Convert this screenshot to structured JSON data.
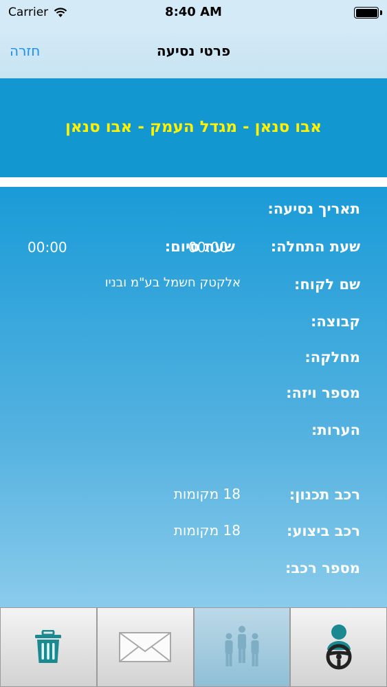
{
  "status_bar": {
    "carrier": "Carrier",
    "time": "8:40 AM"
  },
  "nav": {
    "title": "פרטי נסיעה",
    "back_label": "חזרה"
  },
  "route_title": "אבו סנאן - מגדל העמק - אבו סנאן",
  "fields": {
    "trip_date_label": "תאריך נסיעה:",
    "start_time_label": "שעת התחלה:",
    "start_time_value": "00:00",
    "end_time_label": "שעת סיום:",
    "end_time_value": "00:00",
    "customer_label": "שם לקוח:",
    "customer_value": "אלקטק חשמל בע\"מ ובניו",
    "group_label": "קבוצה:",
    "department_label": "מחלקה:",
    "visa_label": "מספר ויזה:",
    "notes_label": "הערות:",
    "planned_vehicle_label": "רכב תכנון:",
    "planned_vehicle_value": "18 מקומות",
    "actual_vehicle_label": "רכב ביצוע:",
    "actual_vehicle_value": "18 מקומות",
    "vehicle_number_label": "מספר רכב:"
  },
  "colors": {
    "accent": "#1d8ef0",
    "route_title": "#fff200",
    "panel": "#1297d1"
  },
  "tabs": [
    {
      "icon": "trash-icon"
    },
    {
      "icon": "envelope-icon"
    },
    {
      "icon": "passengers-icon"
    },
    {
      "icon": "driver-icon"
    }
  ]
}
